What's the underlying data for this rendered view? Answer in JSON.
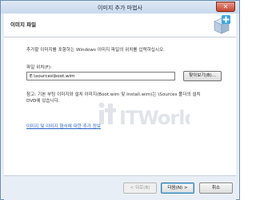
{
  "window": {
    "title": "이미지 추가 마법사",
    "close_label": "✕"
  },
  "header": {
    "title": "이미지 파일",
    "icon": "wizard-server-add-icon"
  },
  "main": {
    "description": "추가할 이미지를 포함하는 Windows 이미지 파일의 위치를 입력하십시오.",
    "path_label": "파일 위치(F):",
    "path_value": "E:\\sources\\boot.wim",
    "browse_label": "찾아보기(B)...",
    "note_line1": "참고: 기본 부팅 이미지와 설치 이미지(Boot.wim 및 Install.wim)는 \\Sources 폴더의 설치",
    "note_line2": "DVD에 있습니다.",
    "info_link": "이미지 및 이미지 형식에 대한 추가 정보",
    "watermark": "ITWorld"
  },
  "footer": {
    "back_label": "< 뒤로(B)",
    "next_label": "다음(N) >",
    "cancel_label": "취소"
  },
  "colors": {
    "accent": "#2a63c4",
    "title_bar": "#c9d9ec",
    "close": "#c6452e"
  }
}
